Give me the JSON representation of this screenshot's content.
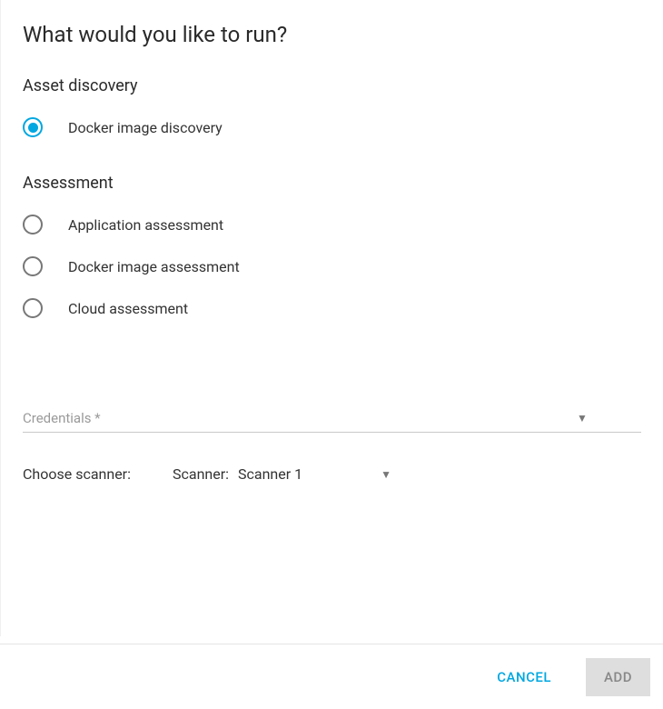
{
  "title": "What would you like to run?",
  "sections": {
    "discovery": {
      "label": "Asset discovery",
      "options": [
        {
          "label": "Docker image discovery",
          "selected": true
        }
      ]
    },
    "assessment": {
      "label": "Assessment",
      "options": [
        {
          "label": "Application assessment",
          "selected": false
        },
        {
          "label": "Docker image assessment",
          "selected": false
        },
        {
          "label": "Cloud assessment",
          "selected": false
        }
      ]
    }
  },
  "credentials": {
    "label": "Credentials *"
  },
  "scanner": {
    "choose_label": "Choose scanner:",
    "prefix": "Scanner:",
    "value": "Scanner 1"
  },
  "footer": {
    "cancel": "CANCEL",
    "add": "ADD"
  },
  "colors": {
    "accent": "#00a7e1"
  }
}
